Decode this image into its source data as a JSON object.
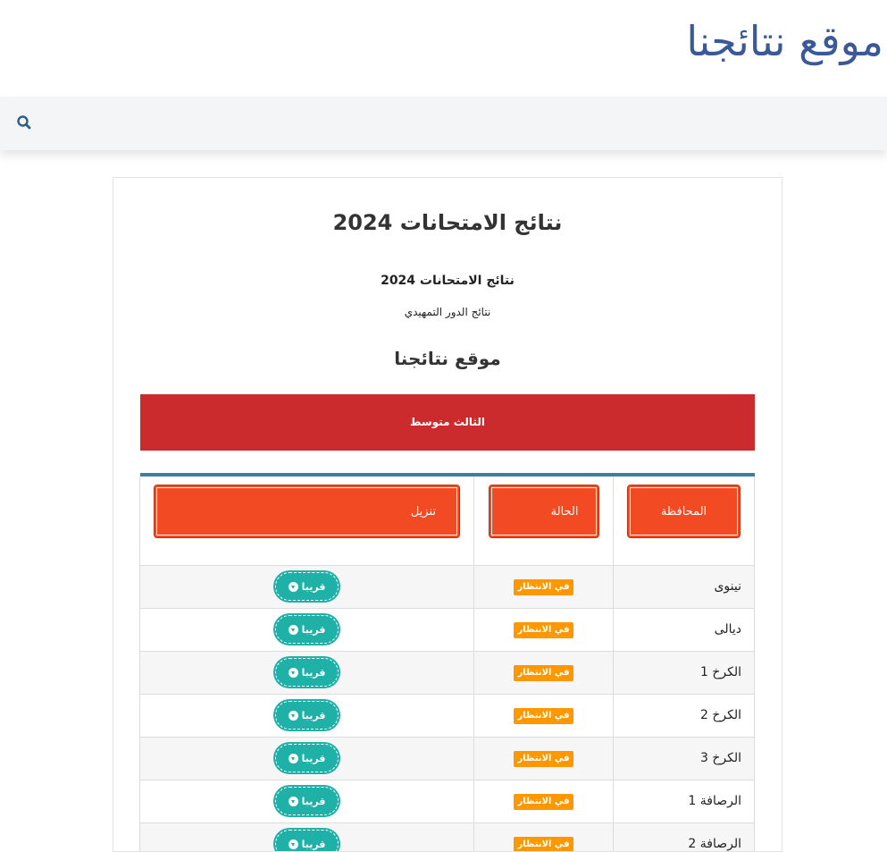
{
  "header": {
    "site_title": "موقع نتائجنا"
  },
  "navbar": {
    "search_icon": "search-icon"
  },
  "post": {
    "title": "نتائج الامتحانات 2024",
    "subtitle": "نتائج الامتحانات 2024",
    "subtitle2": "نتائج الدور التمهيدي",
    "site_heading": "موقع نتائجنا",
    "banner": "الثالث متوسط"
  },
  "table": {
    "headers": {
      "governorate": "المحافظة",
      "status": "الحالة",
      "download": "تنزيل"
    },
    "rows": [
      {
        "governorate": "نينوى",
        "status": "في الانتظار",
        "button": "قريبا"
      },
      {
        "governorate": "ديالى",
        "status": "في الانتظار",
        "button": "قريبا"
      },
      {
        "governorate": "الكرخ 1",
        "status": "في الانتظار",
        "button": "قريبا"
      },
      {
        "governorate": "الكرخ 2",
        "status": "في الانتظار",
        "button": "قريبا"
      },
      {
        "governorate": "الكرخ 3",
        "status": "في الانتظار",
        "button": "قريبا"
      },
      {
        "governorate": "الرصافة 1",
        "status": "في الانتظار",
        "button": "قريبا"
      },
      {
        "governorate": "الرصافة 2",
        "status": "في الانتظار",
        "button": "قريبا"
      }
    ]
  },
  "colors": {
    "title": "#3b5998",
    "banner": "#cc2b2d",
    "header_cell": "#f24a23",
    "badge": "#ff9800",
    "button": "#1fb0a8",
    "table_top_border": "#3d7ea6"
  }
}
